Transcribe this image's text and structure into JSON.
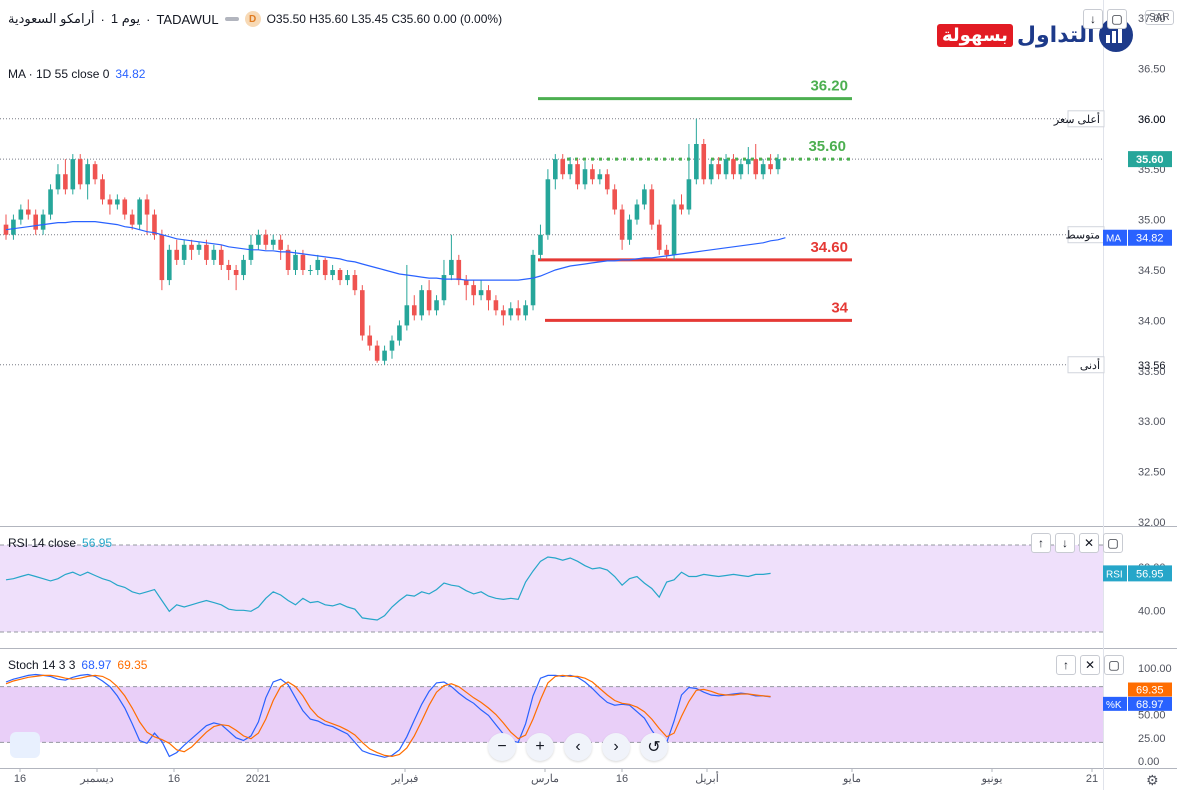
{
  "header": {
    "symbol_name": "أرامكو السعودية",
    "timeframe": "يوم 1",
    "exchange": "TADAWUL",
    "interval_badge": "D",
    "ohlc": "O35.50 H35.60 L35.45 C35.60 0.00 (0.00%)",
    "currency": "SAR",
    "ma_label": "MA · 1D 55 close 0",
    "ma_value": "34.82"
  },
  "logo": {
    "red_text": "بسهولة",
    "blue_text": "التداول"
  },
  "price_tags": {
    "high_label": "أعلى سعر",
    "high_value": "36.00",
    "current_value": "35.60",
    "avg_label": "متوسط",
    "avg_value": "34.85",
    "ma_badge": "MA",
    "ma_badge_value": "34.82",
    "low_label": "أدنى",
    "low_value": "33.56"
  },
  "rsi": {
    "label": "RSI 14 close",
    "value": "56.95",
    "badge": "RSI",
    "badge_value": "56.95"
  },
  "stoch": {
    "label": "Stoch 14 3 3",
    "k_value": "68.97",
    "d_value": "69.35",
    "k_badge": "%K",
    "k_badge_value": "68.97",
    "d_badge_value": "69.35"
  },
  "level_labels": [
    "36.20",
    "35.60",
    "34.60",
    "34"
  ],
  "colors": {
    "up": "#26a69a",
    "down": "#ef5350",
    "ma": "#2962ff",
    "resistance": "#4caf50",
    "support": "#e53935",
    "rsi_line": "#26a6c9",
    "rsi_band": "#efe0fb",
    "stoch_k": "#2962ff",
    "stoch_d": "#ff6d00",
    "stoch_band": "#e9cff8"
  },
  "chart_data": {
    "type": "candlestick",
    "price_axis": {
      "ticks": [
        "37.00",
        "36.50",
        "36.00",
        "35.50",
        "35.00",
        "34.50",
        "34.00",
        "33.50",
        "33.00",
        "32.50",
        "32.00"
      ],
      "range": [
        32.0,
        37.0
      ]
    },
    "time_axis": {
      "labels": [
        "16",
        "ديسمبر",
        "16",
        "2021",
        "فبراير",
        "مارس",
        "16",
        "أبريل",
        "مايو",
        "يونيو",
        "21"
      ]
    },
    "levels": [
      {
        "label": "36.20",
        "value": 36.2,
        "style": "solid",
        "color": "resistance"
      },
      {
        "label": "35.60",
        "value": 35.6,
        "style": "dotted",
        "color": "resistance"
      },
      {
        "label": "34.60",
        "value": 34.6,
        "style": "solid",
        "color": "support"
      },
      {
        "label": "34",
        "value": 34.0,
        "style": "solid",
        "color": "support"
      }
    ],
    "candles": [
      [
        34.95,
        34.85,
        35.05,
        34.8
      ],
      [
        34.85,
        35.0,
        35.05,
        34.8
      ],
      [
        35.0,
        35.1,
        35.15,
        34.95
      ],
      [
        35.1,
        35.05,
        35.2,
        35.0
      ],
      [
        35.05,
        34.9,
        35.1,
        34.85
      ],
      [
        34.9,
        35.05,
        35.1,
        34.85
      ],
      [
        35.05,
        35.3,
        35.35,
        35.0
      ],
      [
        35.3,
        35.45,
        35.55,
        35.25
      ],
      [
        35.45,
        35.3,
        35.6,
        35.25
      ],
      [
        35.3,
        35.6,
        35.65,
        35.25
      ],
      [
        35.6,
        35.35,
        35.65,
        35.3
      ],
      [
        35.35,
        35.55,
        35.6,
        35.2
      ],
      [
        35.55,
        35.4,
        35.58,
        35.35
      ],
      [
        35.4,
        35.2,
        35.45,
        35.15
      ],
      [
        35.2,
        35.15,
        35.25,
        35.05
      ],
      [
        35.15,
        35.2,
        35.25,
        35.1
      ],
      [
        35.2,
        35.05,
        35.22,
        35.0
      ],
      [
        35.05,
        34.95,
        35.1,
        34.9
      ],
      [
        34.95,
        35.2,
        35.22,
        34.9
      ],
      [
        35.2,
        35.05,
        35.25,
        34.85
      ],
      [
        35.05,
        34.85,
        35.1,
        34.8
      ],
      [
        34.85,
        34.4,
        34.9,
        34.3
      ],
      [
        34.4,
        34.7,
        34.75,
        34.35
      ],
      [
        34.7,
        34.6,
        34.8,
        34.55
      ],
      [
        34.6,
        34.75,
        34.8,
        34.55
      ],
      [
        34.75,
        34.7,
        34.8,
        34.6
      ],
      [
        34.7,
        34.75,
        34.78,
        34.65
      ],
      [
        34.75,
        34.6,
        34.8,
        34.55
      ],
      [
        34.6,
        34.7,
        34.75,
        34.55
      ],
      [
        34.7,
        34.55,
        34.75,
        34.5
      ],
      [
        34.55,
        34.5,
        34.6,
        34.4
      ],
      [
        34.5,
        34.45,
        34.55,
        34.3
      ],
      [
        34.45,
        34.6,
        34.65,
        34.4
      ],
      [
        34.6,
        34.75,
        34.85,
        34.55
      ],
      [
        34.75,
        34.85,
        34.9,
        34.7
      ],
      [
        34.85,
        34.75,
        34.9,
        34.7
      ],
      [
        34.75,
        34.8,
        34.85,
        34.7
      ],
      [
        34.8,
        34.7,
        34.85,
        34.6
      ],
      [
        34.7,
        34.5,
        34.75,
        34.45
      ],
      [
        34.5,
        34.65,
        34.7,
        34.45
      ],
      [
        34.65,
        34.5,
        34.7,
        34.45
      ],
      [
        34.5,
        34.5,
        34.55,
        34.45
      ],
      [
        34.5,
        34.6,
        34.65,
        34.45
      ],
      [
        34.6,
        34.45,
        34.62,
        34.4
      ],
      [
        34.45,
        34.5,
        34.55,
        34.4
      ],
      [
        34.5,
        34.4,
        34.52,
        34.35
      ],
      [
        34.4,
        34.45,
        34.5,
        34.35
      ],
      [
        34.45,
        34.3,
        34.5,
        34.25
      ],
      [
        34.3,
        33.85,
        34.35,
        33.8
      ],
      [
        33.85,
        33.75,
        33.95,
        33.7
      ],
      [
        33.75,
        33.6,
        33.8,
        33.58
      ],
      [
        33.6,
        33.7,
        33.75,
        33.56
      ],
      [
        33.7,
        33.8,
        33.85,
        33.62
      ],
      [
        33.8,
        33.95,
        34.0,
        33.75
      ],
      [
        33.95,
        34.15,
        34.55,
        33.9
      ],
      [
        34.15,
        34.05,
        34.25,
        34.0
      ],
      [
        34.05,
        34.3,
        34.35,
        34.0
      ],
      [
        34.3,
        34.1,
        34.4,
        34.05
      ],
      [
        34.1,
        34.2,
        34.25,
        34.05
      ],
      [
        34.2,
        34.45,
        34.6,
        34.15
      ],
      [
        34.45,
        34.6,
        34.85,
        34.4
      ],
      [
        34.6,
        34.4,
        34.65,
        34.35
      ],
      [
        34.4,
        34.35,
        34.45,
        34.2
      ],
      [
        34.35,
        34.25,
        34.4,
        34.15
      ],
      [
        34.25,
        34.3,
        34.4,
        34.2
      ],
      [
        34.3,
        34.2,
        34.35,
        34.1
      ],
      [
        34.2,
        34.1,
        34.25,
        34.05
      ],
      [
        34.1,
        34.05,
        34.15,
        33.95
      ],
      [
        34.05,
        34.12,
        34.18,
        34.0
      ],
      [
        34.12,
        34.05,
        34.2,
        34.0
      ],
      [
        34.05,
        34.15,
        34.2,
        34.0
      ],
      [
        34.15,
        34.65,
        34.7,
        34.1
      ],
      [
        34.65,
        34.85,
        34.95,
        34.6
      ],
      [
        34.85,
        35.4,
        35.5,
        34.8
      ],
      [
        35.4,
        35.6,
        35.65,
        35.3
      ],
      [
        35.6,
        35.45,
        35.65,
        35.4
      ],
      [
        35.45,
        35.55,
        35.62,
        35.4
      ],
      [
        35.55,
        35.35,
        35.6,
        35.3
      ],
      [
        35.35,
        35.5,
        35.58,
        35.3
      ],
      [
        35.5,
        35.4,
        35.55,
        35.35
      ],
      [
        35.4,
        35.45,
        35.5,
        35.35
      ],
      [
        35.45,
        35.3,
        35.5,
        35.25
      ],
      [
        35.3,
        35.1,
        35.35,
        35.05
      ],
      [
        35.1,
        34.8,
        35.15,
        34.7
      ],
      [
        34.8,
        35.0,
        35.05,
        34.75
      ],
      [
        35.0,
        35.15,
        35.2,
        34.95
      ],
      [
        35.15,
        35.3,
        35.35,
        35.1
      ],
      [
        35.3,
        34.95,
        35.35,
        34.9
      ],
      [
        34.95,
        34.7,
        35.0,
        34.65
      ],
      [
        34.7,
        34.65,
        34.75,
        34.6
      ],
      [
        34.65,
        35.15,
        35.2,
        34.6
      ],
      [
        35.15,
        35.1,
        35.25,
        35.05
      ],
      [
        35.1,
        35.4,
        35.75,
        35.05
      ],
      [
        35.4,
        35.75,
        36.0,
        35.35
      ],
      [
        35.75,
        35.4,
        35.8,
        35.35
      ],
      [
        35.4,
        35.55,
        35.6,
        35.35
      ],
      [
        35.55,
        35.45,
        35.62,
        35.4
      ],
      [
        35.45,
        35.6,
        35.65,
        35.4
      ],
      [
        35.6,
        35.45,
        35.65,
        35.4
      ],
      [
        35.45,
        35.55,
        35.6,
        35.4
      ],
      [
        35.55,
        35.6,
        35.72,
        35.45
      ],
      [
        35.6,
        35.45,
        35.75,
        35.4
      ],
      [
        35.45,
        35.55,
        35.6,
        35.4
      ],
      [
        35.55,
        35.5,
        35.65,
        35.45
      ],
      [
        35.5,
        35.6,
        35.65,
        35.45
      ]
    ],
    "ma": [
      34.9,
      34.91,
      34.92,
      34.93,
      34.94,
      34.95,
      34.96,
      34.97,
      34.97,
      34.98,
      34.98,
      34.98,
      34.98,
      34.97,
      34.96,
      34.95,
      34.93,
      34.92,
      34.9,
      34.88,
      34.87,
      34.85,
      34.83,
      34.81,
      34.8,
      34.79,
      34.78,
      34.77,
      34.76,
      34.75,
      34.73,
      34.72,
      34.71,
      34.7,
      34.7,
      34.69,
      34.69,
      34.68,
      34.68,
      34.67,
      34.66,
      34.65,
      34.64,
      34.63,
      34.62,
      34.61,
      34.59,
      34.58,
      34.56,
      34.54,
      34.52,
      34.5,
      34.48,
      34.46,
      34.45,
      34.44,
      34.43,
      34.42,
      34.42,
      34.41,
      34.41,
      34.41,
      34.4,
      34.4,
      34.4,
      34.4,
      34.4,
      34.4,
      34.4,
      34.4,
      34.41,
      34.42,
      34.44,
      34.47,
      34.5,
      34.52,
      34.54,
      34.55,
      34.56,
      34.57,
      34.58,
      34.59,
      34.59,
      34.6,
      34.6,
      34.61,
      34.62,
      34.62,
      34.63,
      34.64,
      34.65,
      34.66,
      34.67,
      34.68,
      34.69,
      34.7,
      34.71,
      34.72,
      34.73,
      34.74,
      34.75,
      34.76,
      34.77,
      34.79,
      34.8,
      34.82
    ],
    "rsi": {
      "ticks": [
        "60.00",
        "40.00"
      ],
      "range": [
        30,
        70
      ],
      "band": [
        30,
        70
      ],
      "values": [
        54.0,
        54.5,
        55.5,
        56.5,
        55.5,
        54.5,
        53.5,
        54.5,
        56.5,
        57.5,
        56.0,
        57.5,
        56.0,
        54.5,
        53.5,
        51.5,
        50.5,
        48.5,
        47.5,
        48.5,
        49.5,
        44.5,
        39.5,
        42.5,
        41.5,
        42.5,
        43.5,
        44.5,
        43.5,
        42.5,
        40.5,
        40.0,
        40.0,
        39.5,
        41.5,
        45.5,
        48.5,
        47.0,
        44.5,
        42.5,
        45.5,
        43.5,
        44.0,
        42.5,
        42.0,
        43.0,
        41.5,
        40.5,
        36.5,
        36.0,
        35.5,
        37.5,
        41.5,
        44.5,
        47.0,
        46.5,
        48.5,
        47.5,
        49.5,
        52.5,
        51.5,
        51.0,
        49.0,
        47.5,
        48.5,
        46.5,
        45.5,
        45.0,
        45.5,
        45.0,
        53.0,
        58.0,
        62.5,
        64.5,
        64.0,
        63.0,
        64.0,
        62.5,
        60.5,
        59.0,
        59.5,
        58.5,
        55.5,
        51.5,
        54.5,
        55.5,
        52.5,
        50.0,
        46.0,
        53.0,
        54.0,
        57.5,
        55.5,
        55.5,
        56.5,
        56.0,
        55.5,
        56.0,
        56.5,
        56.0,
        55.5,
        56.5,
        56.5,
        56.95
      ]
    },
    "stochastic": {
      "ticks": [
        "100.00",
        "75.00",
        "50.00",
        "25.00",
        "0.00"
      ],
      "range": [
        0,
        100
      ],
      "band": [
        20,
        80
      ],
      "k": [
        85,
        88,
        90,
        92,
        93,
        92,
        91,
        88,
        87,
        90,
        92,
        93,
        91,
        86,
        80,
        70,
        57,
        40,
        22,
        19,
        30,
        21,
        5,
        9,
        17,
        24,
        31,
        38,
        41,
        39,
        32,
        25,
        22,
        27,
        42,
        68,
        85,
        88,
        82,
        68,
        54,
        45,
        43,
        39,
        37,
        33,
        29,
        20,
        11,
        8,
        6,
        4,
        6,
        12,
        26,
        44,
        61,
        75,
        84,
        85,
        80,
        73,
        67,
        62,
        55,
        49,
        39,
        29,
        22,
        20,
        40,
        70,
        89,
        92,
        92,
        91,
        92,
        90,
        85,
        78,
        70,
        63,
        60,
        61,
        60,
        53,
        46,
        33,
        22,
        20,
        43,
        71,
        79,
        78,
        74,
        71,
        70,
        71,
        72,
        73,
        72,
        70,
        70,
        68.97
      ],
      "d": [
        83,
        86,
        88,
        90,
        91,
        92,
        92,
        91,
        89,
        88,
        89,
        91,
        92,
        91,
        87,
        80,
        70,
        57,
        42,
        31,
        26,
        23,
        19,
        12,
        10,
        15,
        23,
        31,
        37,
        39,
        38,
        33,
        27,
        24,
        30,
        45,
        65,
        80,
        85,
        80,
        70,
        57,
        48,
        43,
        40,
        37,
        33,
        28,
        20,
        13,
        9,
        6,
        5,
        7,
        14,
        27,
        43,
        60,
        74,
        81,
        83,
        80,
        74,
        68,
        63,
        57,
        50,
        41,
        31,
        24,
        28,
        45,
        66,
        84,
        91,
        92,
        91,
        91,
        89,
        85,
        78,
        71,
        65,
        62,
        61,
        58,
        53,
        45,
        35,
        26,
        30,
        48,
        64,
        76,
        77,
        75,
        72,
        71,
        71,
        72,
        72,
        71,
        70,
        69.35
      ]
    }
  }
}
